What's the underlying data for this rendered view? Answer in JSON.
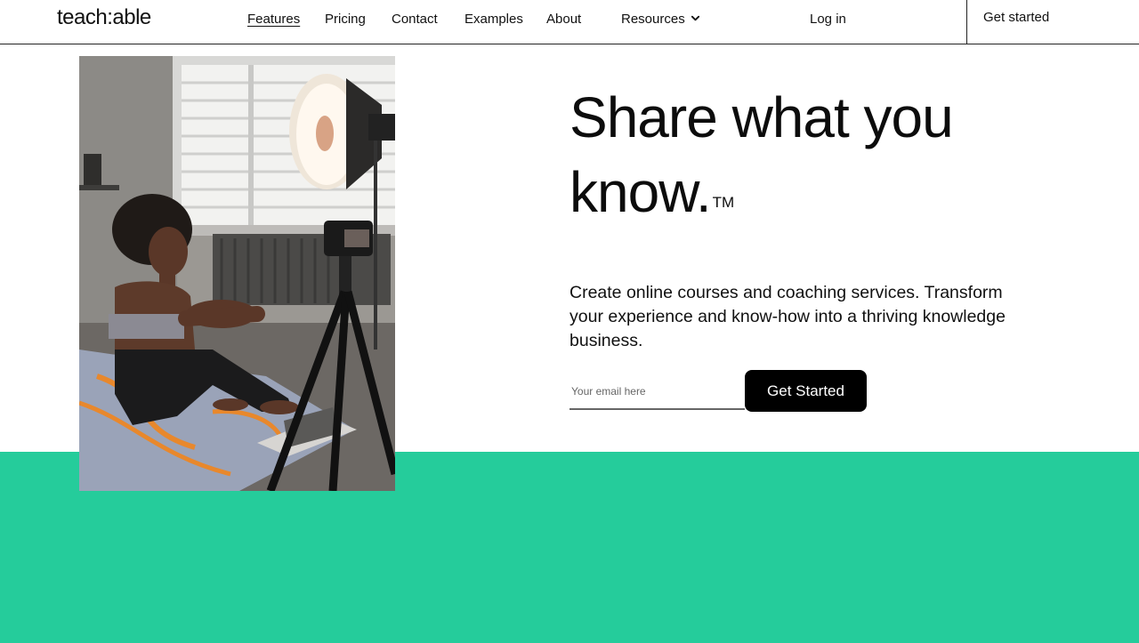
{
  "header": {
    "logo": "teach:able",
    "nav": [
      {
        "label": "Features"
      },
      {
        "label": "Pricing"
      },
      {
        "label": "Contact"
      },
      {
        "label": "Examples"
      },
      {
        "label": "About"
      },
      {
        "label": "Resources",
        "icon": "chevron-down-icon"
      }
    ],
    "login": "Log in",
    "cta": "Get started"
  },
  "hero": {
    "headline_line1": "Share what you",
    "headline_line2": "know.",
    "trademark": "TM",
    "subtext": "Create online courses and coaching services. Transform your experience and know-how into a thriving knowledge business.",
    "email_placeholder": "Your email here",
    "cta_button": "Get Started"
  },
  "colors": {
    "accent_green": "#25cc9b",
    "button_black": "#000000",
    "text": "#111111"
  }
}
